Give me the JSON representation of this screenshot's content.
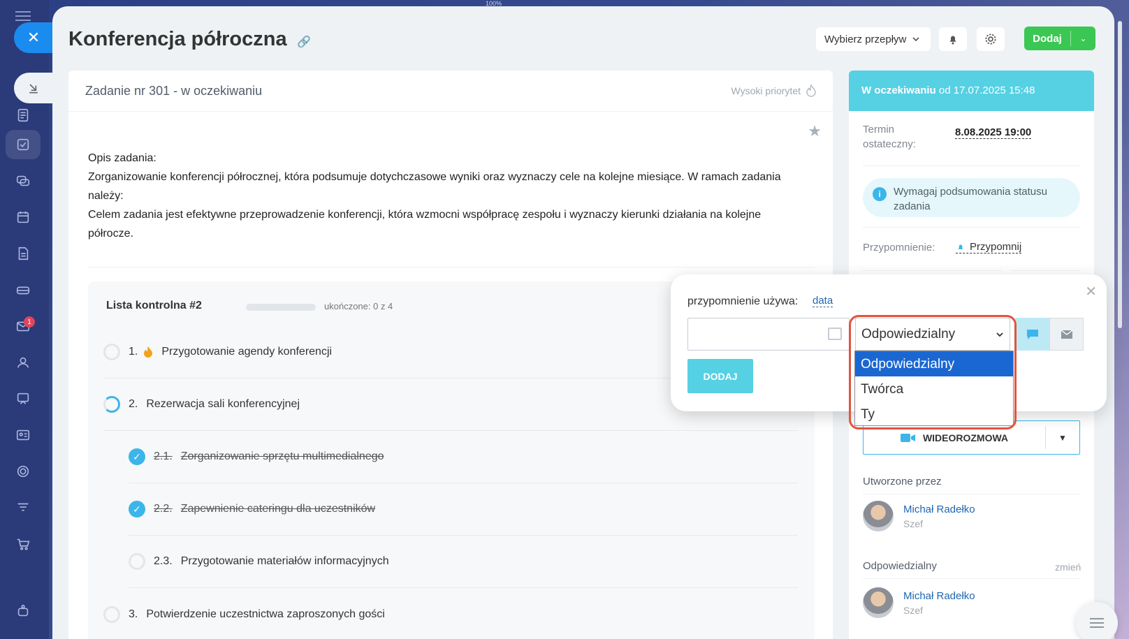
{
  "top_zoom": "100%",
  "sidebar": {
    "mail_badge": "1"
  },
  "header": {
    "title": "Konferencja półroczna",
    "flow_label": "Wybierz przepływ",
    "add_label": "Dodaj"
  },
  "task": {
    "heading": "Zadanie nr 301 - w oczekiwaniu",
    "priority": "Wysoki priorytet",
    "description": [
      "Opis zadania:",
      "Zorganizowanie konferencji półrocznej, która podsumuje dotychczasowe wyniki oraz wyznaczy cele na kolejne miesiące. W ramach zadania należy:",
      "Celem zadania jest efektywne przeprowadzenie konferencji, która wzmocni współpracę zespołu i wyznaczy kierunki działania na kolejne półrocze."
    ]
  },
  "checklist": {
    "title": "Lista kontrolna #2",
    "progress": "ukończone: 0 z 4",
    "items": [
      {
        "num": "1.",
        "label": "Przygotowanie agendy konferencji"
      },
      {
        "num": "2.",
        "label": "Rezerwacja sali konferencyjnej"
      },
      {
        "num": "2.1.",
        "label": "Zorganizowanie sprzętu multimedialnego"
      },
      {
        "num": "2.2.",
        "label": "Zapewnienie cateringu dla uczestników"
      },
      {
        "num": "2.3.",
        "label": "Przygotowanie materiałów informacyjnych"
      },
      {
        "num": "3.",
        "label": "Potwierdzenie uczestnictwa zaproszonych gości"
      }
    ]
  },
  "right": {
    "status_bold": "W oczekiwaniu",
    "status_rest": " od 17.07.2025 15:48",
    "deadline_label_1": "Termin",
    "deadline_label_2": "ostateczny:",
    "deadline_value": "8.08.2025 19:00",
    "info_text": "Wymagaj podsumowania statusu zadania",
    "reminder_label": "Przypomnienie:",
    "reminder_link": "Przypomnij",
    "video_label": "WIDEOROZMOWA",
    "created_label": "Utworzone przez",
    "creator_name": "Michał Radełko",
    "creator_role": "Szef",
    "responsible_label": "Odpowiedzialny",
    "change_label": "zmień",
    "responsible_name": "Michał Radełko",
    "responsible_role": "Szef"
  },
  "popup": {
    "uses_label": "przypomnienie używa:",
    "uses_link": "data",
    "date_placeholder": "",
    "select_value": "Odpowiedzialny",
    "options": [
      "Odpowiedzialny",
      "Twórca",
      "Ty"
    ],
    "add_button": "DODAJ"
  }
}
